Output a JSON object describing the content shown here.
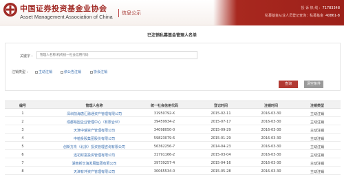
{
  "header": {
    "org_name_cn": "中国证券投资基金业协会",
    "org_name_en": "Asset Management Association of China",
    "section": "信息公示",
    "hotline_label": "投 诉 热 线 :",
    "hotline_value": "71783348",
    "tipline_label": "私募基金从业人员登记查询：私募基金",
    "tipline_value": "40861-8"
  },
  "page": {
    "title": "已注销私募基金管理人名单"
  },
  "filter": {
    "keyword_label": "关键字 :",
    "keyword_placeholder": "管理人名称/机构统一社会信用代码",
    "status_label": "注销类型 :",
    "status_options": [
      "主动注销",
      "依公告注销",
      "协会注销"
    ],
    "search_button": "查询",
    "reset_button": "清空条件"
  },
  "table": {
    "headers": [
      "编号",
      "管理人名称",
      "统一社会信用代码",
      "登记时间",
      "注销时间",
      "注销类型"
    ],
    "rows": [
      [
        "1",
        "深圳前海唐汇融通资产管理有限公司",
        "31950792-X",
        "2015-02-11",
        "2016-03-30",
        "主动注销"
      ],
      [
        "2",
        "成都易固企业管理中心（有限合伙）",
        "39459934-2",
        "2015-07-17",
        "2016-03-30",
        "主动注销"
      ],
      [
        "3",
        "天津中瑞资产管理有限公司",
        "34098050-0",
        "2015-09-29",
        "2016-03-30",
        "主动注销"
      ],
      [
        "4",
        "中植投股集团股份有限公司",
        "59823079-6",
        "2015-01-29",
        "2016-03-30",
        "主动注销"
      ],
      [
        "5",
        "创新方舟（北京）投资管理咨询有限公司",
        "56362256-7",
        "2014-04-23",
        "2016-03-30",
        "主动注销"
      ],
      [
        "6",
        "迅初财富投资管理有限公司",
        "31791166-2",
        "2015-03-04",
        "2016-03-30",
        "主动注销"
      ],
      [
        "7",
        "湖南新长海发展集团有限公司",
        "39739257-4",
        "2015-04-16",
        "2016-03-30",
        "主动注销"
      ],
      [
        "8",
        "天津有冲资产管理有限公司",
        "30065534-0",
        "2015-05-28",
        "2016-03-30",
        "主动注销"
      ]
    ]
  }
}
